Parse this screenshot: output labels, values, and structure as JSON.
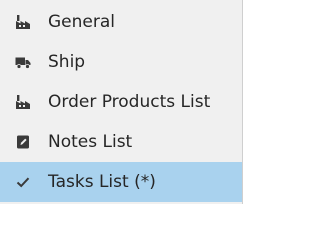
{
  "menu": {
    "items": [
      {
        "label": "General",
        "icon": "factory-icon",
        "selected": false
      },
      {
        "label": "Ship",
        "icon": "truck-icon",
        "selected": false
      },
      {
        "label": "Order Products List",
        "icon": "factory-icon",
        "selected": false
      },
      {
        "label": "Notes List",
        "icon": "note-icon",
        "selected": false
      },
      {
        "label": "Tasks List (*)",
        "icon": "checkmark-icon",
        "selected": true
      }
    ]
  },
  "colors": {
    "background": "#f0f0f0",
    "selected_background": "#a9d2ee",
    "text": "#262626",
    "icon": "#3a3a3a"
  }
}
